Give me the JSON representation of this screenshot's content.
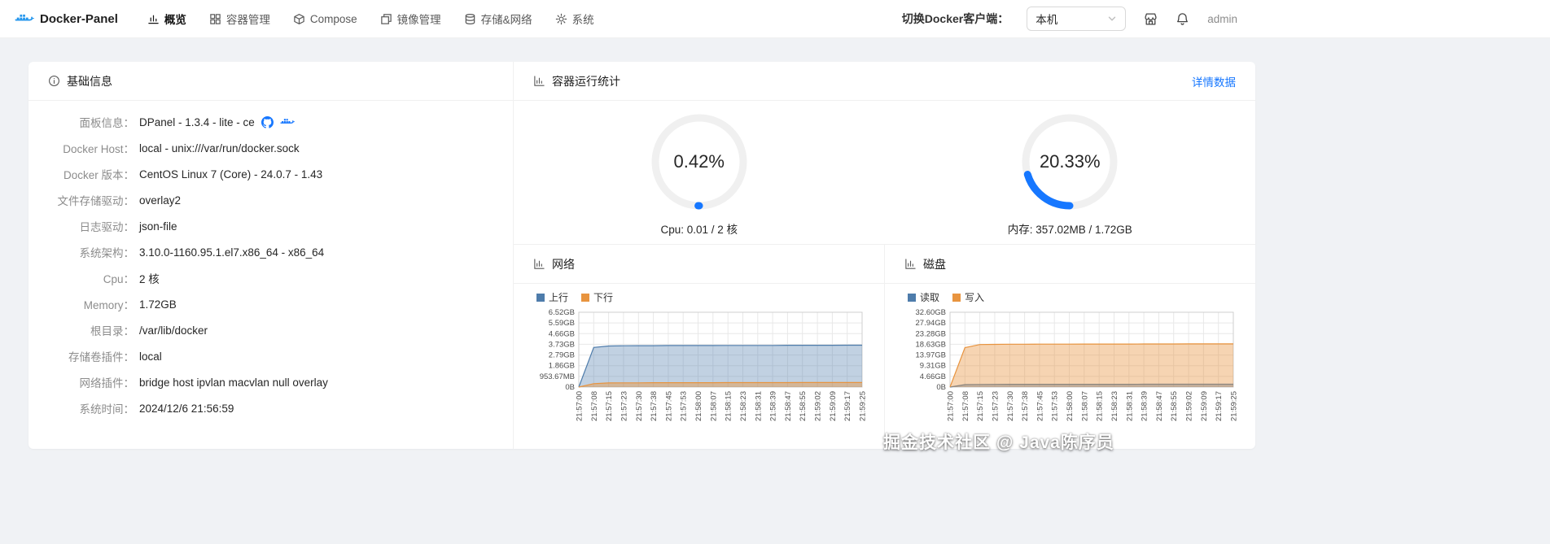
{
  "header": {
    "brand": "Docker-Panel",
    "nav": [
      {
        "id": "overview",
        "label": "概览",
        "icon": "chart-icon",
        "active": true
      },
      {
        "id": "containers",
        "label": "容器管理",
        "icon": "grid-icon",
        "active": false
      },
      {
        "id": "compose",
        "label": "Compose",
        "icon": "package-icon",
        "active": false
      },
      {
        "id": "images",
        "label": "镜像管理",
        "icon": "layers-icon",
        "active": false
      },
      {
        "id": "storage",
        "label": "存储&网络",
        "icon": "database-icon",
        "active": false
      },
      {
        "id": "system",
        "label": "系统",
        "icon": "gear-icon",
        "active": false
      }
    ],
    "client_switch_label": "切换Docker客户端：",
    "client_select_value": "本机",
    "username": "admin"
  },
  "basic_info": {
    "title": "基础信息",
    "rows": [
      {
        "label": "面板信息",
        "value": "DPanel - 1.3.4 - lite - ce",
        "icons": [
          "github-icon",
          "docker-icon"
        ]
      },
      {
        "label": "Docker Host",
        "value": "local - unix:///var/run/docker.sock"
      },
      {
        "label": "Docker 版本",
        "value": "CentOS Linux 7 (Core) - 24.0.7 - 1.43"
      },
      {
        "label": "文件存储驱动",
        "value": "overlay2"
      },
      {
        "label": "日志驱动",
        "value": "json-file"
      },
      {
        "label": "系统架构",
        "value": "3.10.0-1160.95.1.el7.x86_64 - x86_64"
      },
      {
        "label": "Cpu",
        "value": "2 核"
      },
      {
        "label": "Memory",
        "value": "1.72GB"
      },
      {
        "label": "根目录",
        "value": "/var/lib/docker"
      },
      {
        "label": "存储卷插件",
        "value": "local"
      },
      {
        "label": "网络插件",
        "value": "bridge host ipvlan macvlan null overlay"
      },
      {
        "label": "系统时间",
        "value": "2024/12/6 21:56:59"
      }
    ]
  },
  "stats": {
    "title": "容器运行统计",
    "detail_link": "详情数据",
    "accent_color": "#1677ff",
    "gauges": [
      {
        "id": "cpu",
        "percent": 0.42,
        "display": "0.42%",
        "caption": "Cpu: 0.01 / 2 核"
      },
      {
        "id": "memory",
        "percent": 20.33,
        "display": "20.33%",
        "caption": "内存: 357.02MB / 1.72GB"
      }
    ]
  },
  "chart_data": [
    {
      "name": "network",
      "title": "网络",
      "type": "area",
      "legend_position": "top-left",
      "grid": true,
      "xlabel": "",
      "ylabel": "",
      "ymax_gb": 6.52,
      "y_ticks": [
        "0B",
        "953.67MB",
        "1.86GB",
        "2.79GB",
        "3.73GB",
        "4.66GB",
        "5.59GB",
        "6.52GB"
      ],
      "x": [
        "21:57:00",
        "21:57:08",
        "21:57:15",
        "21:57:23",
        "21:57:30",
        "21:57:38",
        "21:57:45",
        "21:57:53",
        "21:58:00",
        "21:58:07",
        "21:58:15",
        "21:58:23",
        "21:58:31",
        "21:58:39",
        "21:58:47",
        "21:58:55",
        "21:59:02",
        "21:59:09",
        "21:59:17",
        "21:59:25"
      ],
      "series": [
        {
          "name": "上行",
          "color": "#4e7cab",
          "fill": "rgba(78,124,171,0.35)",
          "values_gb": [
            0,
            3.45,
            3.58,
            3.6,
            3.61,
            3.61,
            3.62,
            3.62,
            3.62,
            3.62,
            3.63,
            3.63,
            3.63,
            3.63,
            3.64,
            3.64,
            3.64,
            3.64,
            3.65,
            3.65
          ]
        },
        {
          "name": "下行",
          "color": "#e8943f",
          "fill": "rgba(232,148,63,0.45)",
          "values_gb": [
            0,
            0.3,
            0.36,
            0.37,
            0.37,
            0.38,
            0.38,
            0.38,
            0.38,
            0.38,
            0.39,
            0.39,
            0.39,
            0.39,
            0.39,
            0.4,
            0.4,
            0.4,
            0.4,
            0.4
          ]
        }
      ]
    },
    {
      "name": "disk",
      "title": "磁盘",
      "type": "area",
      "legend_position": "top-left",
      "grid": true,
      "xlabel": "",
      "ylabel": "",
      "ymax_gb": 32.6,
      "y_ticks": [
        "0B",
        "4.66GB",
        "9.31GB",
        "13.97GB",
        "18.63GB",
        "23.28GB",
        "27.94GB",
        "32.60GB"
      ],
      "x": [
        "21:57:00",
        "21:57:08",
        "21:57:15",
        "21:57:23",
        "21:57:30",
        "21:57:38",
        "21:57:45",
        "21:57:53",
        "21:58:00",
        "21:58:07",
        "21:58:15",
        "21:58:23",
        "21:58:31",
        "21:58:39",
        "21:58:47",
        "21:58:55",
        "21:59:02",
        "21:59:09",
        "21:59:17",
        "21:59:25"
      ],
      "series": [
        {
          "name": "读取",
          "color": "#4e7cab",
          "fill": "rgba(78,124,171,0.45)",
          "values_gb": [
            0,
            1.05,
            1.15,
            1.18,
            1.2,
            1.2,
            1.21,
            1.21,
            1.21,
            1.22,
            1.22,
            1.22,
            1.22,
            1.23,
            1.23,
            1.23,
            1.23,
            1.23,
            1.24,
            1.24
          ]
        },
        {
          "name": "写入",
          "color": "#e8943f",
          "fill": "rgba(232,148,63,0.40)",
          "values_gb": [
            0,
            17.2,
            18.55,
            18.62,
            18.66,
            18.68,
            18.7,
            18.71,
            18.72,
            18.73,
            18.74,
            18.75,
            18.76,
            18.77,
            18.78,
            18.79,
            18.8,
            18.81,
            18.82,
            18.83
          ]
        }
      ]
    }
  ],
  "watermark": {
    "text": "掘金技术社区 @ Java陈序员"
  }
}
